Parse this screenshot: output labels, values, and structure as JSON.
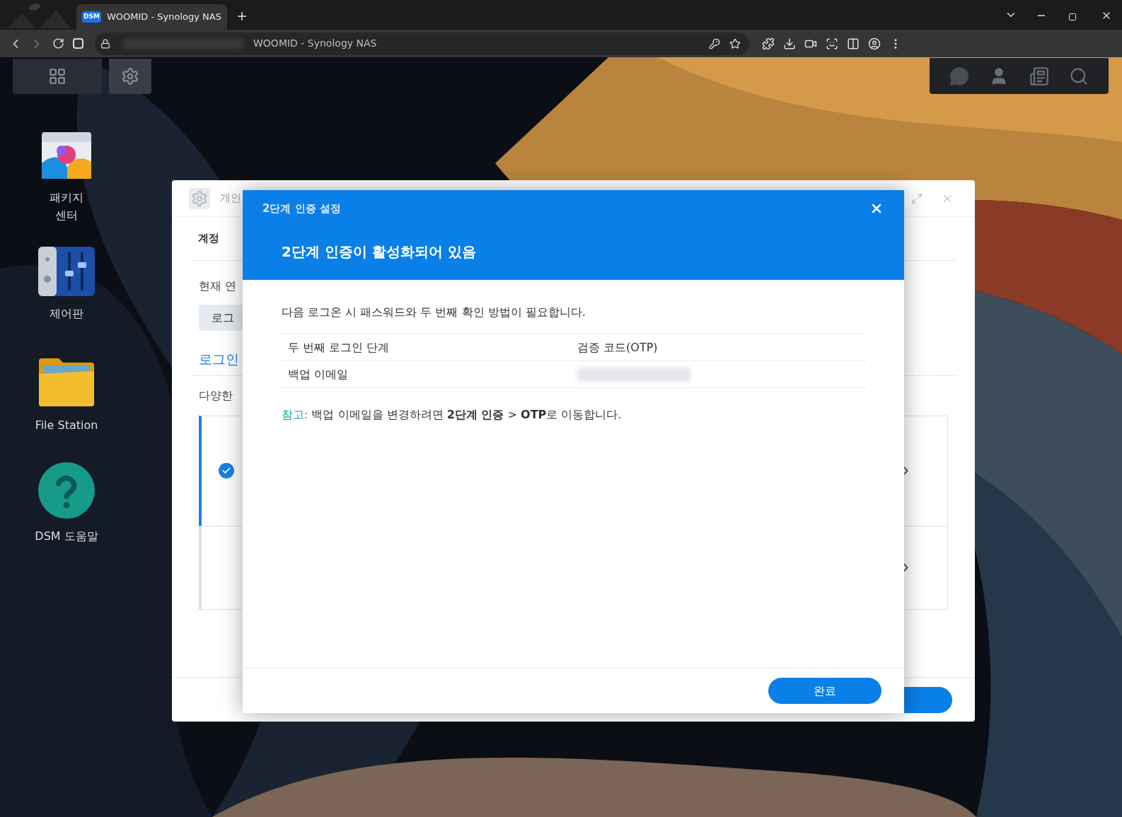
{
  "browser": {
    "tab": {
      "favicon": "DSM",
      "title": "WOOMID - Synology NAS",
      "selected": true
    },
    "address": {
      "page_title": "WOOMID - Synology NAS"
    }
  },
  "desktop": {
    "icons": [
      {
        "kind": "package",
        "label": "패키지 센터"
      },
      {
        "kind": "control",
        "label": "제어판"
      },
      {
        "kind": "folder",
        "label": "File Station"
      },
      {
        "kind": "help",
        "label": "DSM 도움말"
      }
    ]
  },
  "background_window": {
    "title": "개인",
    "section": "계정",
    "row_label": "현재 연",
    "button": "로그",
    "link": "로그인",
    "description": "다양한",
    "cards": [
      {
        "selected": true
      },
      {
        "selected": false
      }
    ]
  },
  "dialog": {
    "title": "2단계 인증 설정",
    "heading": "2단계 인증이 활성화되어 있음",
    "intro": "다음 로그온 시 패스워드와 두 번째 확인 방법이 필요합니다.",
    "rows": [
      {
        "label": "두 번째 로그인 단계",
        "value": "검증 코드(OTP)"
      },
      {
        "label": "백업 이메일",
        "value": null
      }
    ],
    "note_label": "참고:",
    "note": "백업 이메일을 변경하려면 **2단계 인증** > **OTP**로 이동합니다.",
    "done_button": "완료"
  }
}
